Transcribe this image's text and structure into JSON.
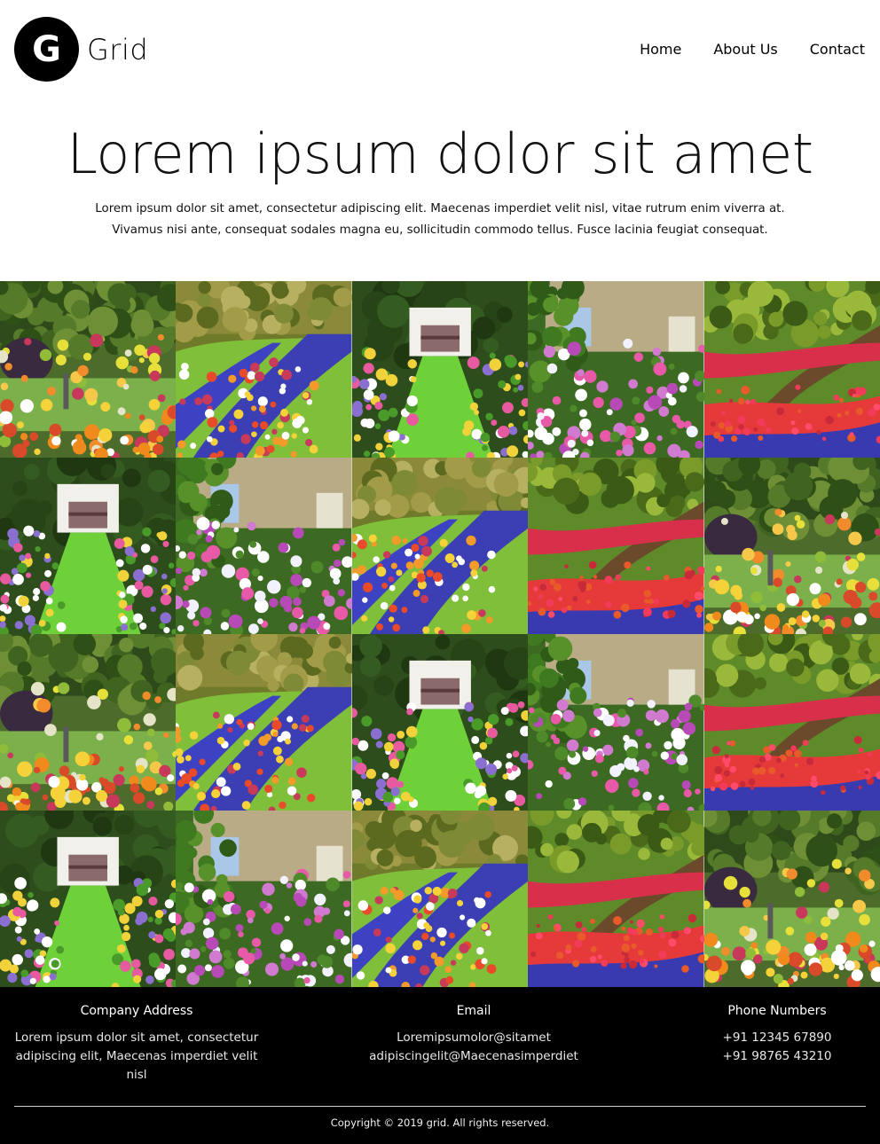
{
  "header": {
    "logo_letter": "G",
    "logo_text": "Grid",
    "nav": [
      {
        "label": "Home"
      },
      {
        "label": "About Us"
      },
      {
        "label": "Contact"
      }
    ]
  },
  "hero": {
    "title": "Lorem ipsum dolor sit amet",
    "text": "Lorem ipsum dolor sit amet, consectetur adipiscing elit. Maecenas imperdiet velit nisl, vitae rutrum enim viverra at. Vivamus nisi ante, consequat sodales magna eu, sollicitudin commodo tellus. Fusce lacinia feugiat consequat."
  },
  "gallery": {
    "columns": 5,
    "rows": 4,
    "tiles": [
      "rock-garden",
      "tulip-path",
      "gazebo-path",
      "cottage-flowers",
      "canal-tulips",
      "gazebo-path",
      "cottage-flowers",
      "tulip-path",
      "canal-tulips",
      "rock-garden",
      "rock-garden",
      "tulip-path",
      "gazebo-path",
      "cottage-flowers",
      "canal-tulips",
      "gazebo-path",
      "cottage-flowers",
      "tulip-path",
      "canal-tulips",
      "rock-garden"
    ]
  },
  "footer": {
    "address": {
      "heading": "Company Address",
      "text": "Lorem ipsum dolor sit amet, consectetur adipiscing elit, Maecenas imperdiet velit nisl"
    },
    "email": {
      "heading": "Email",
      "line1": "Loremipsumolor@sitamet",
      "line2": "adipiscingelit@Maecenasimperdiet"
    },
    "phone": {
      "heading": "Phone Numbers",
      "line1": "+91 12345 67890",
      "line2": "+91 98765 43210"
    },
    "copyright": "Copyright © 2019 grid. All rights reserved."
  },
  "colors": {
    "background": "#ffffff",
    "footer_bg": "#000000",
    "logo_bg": "#000000"
  }
}
